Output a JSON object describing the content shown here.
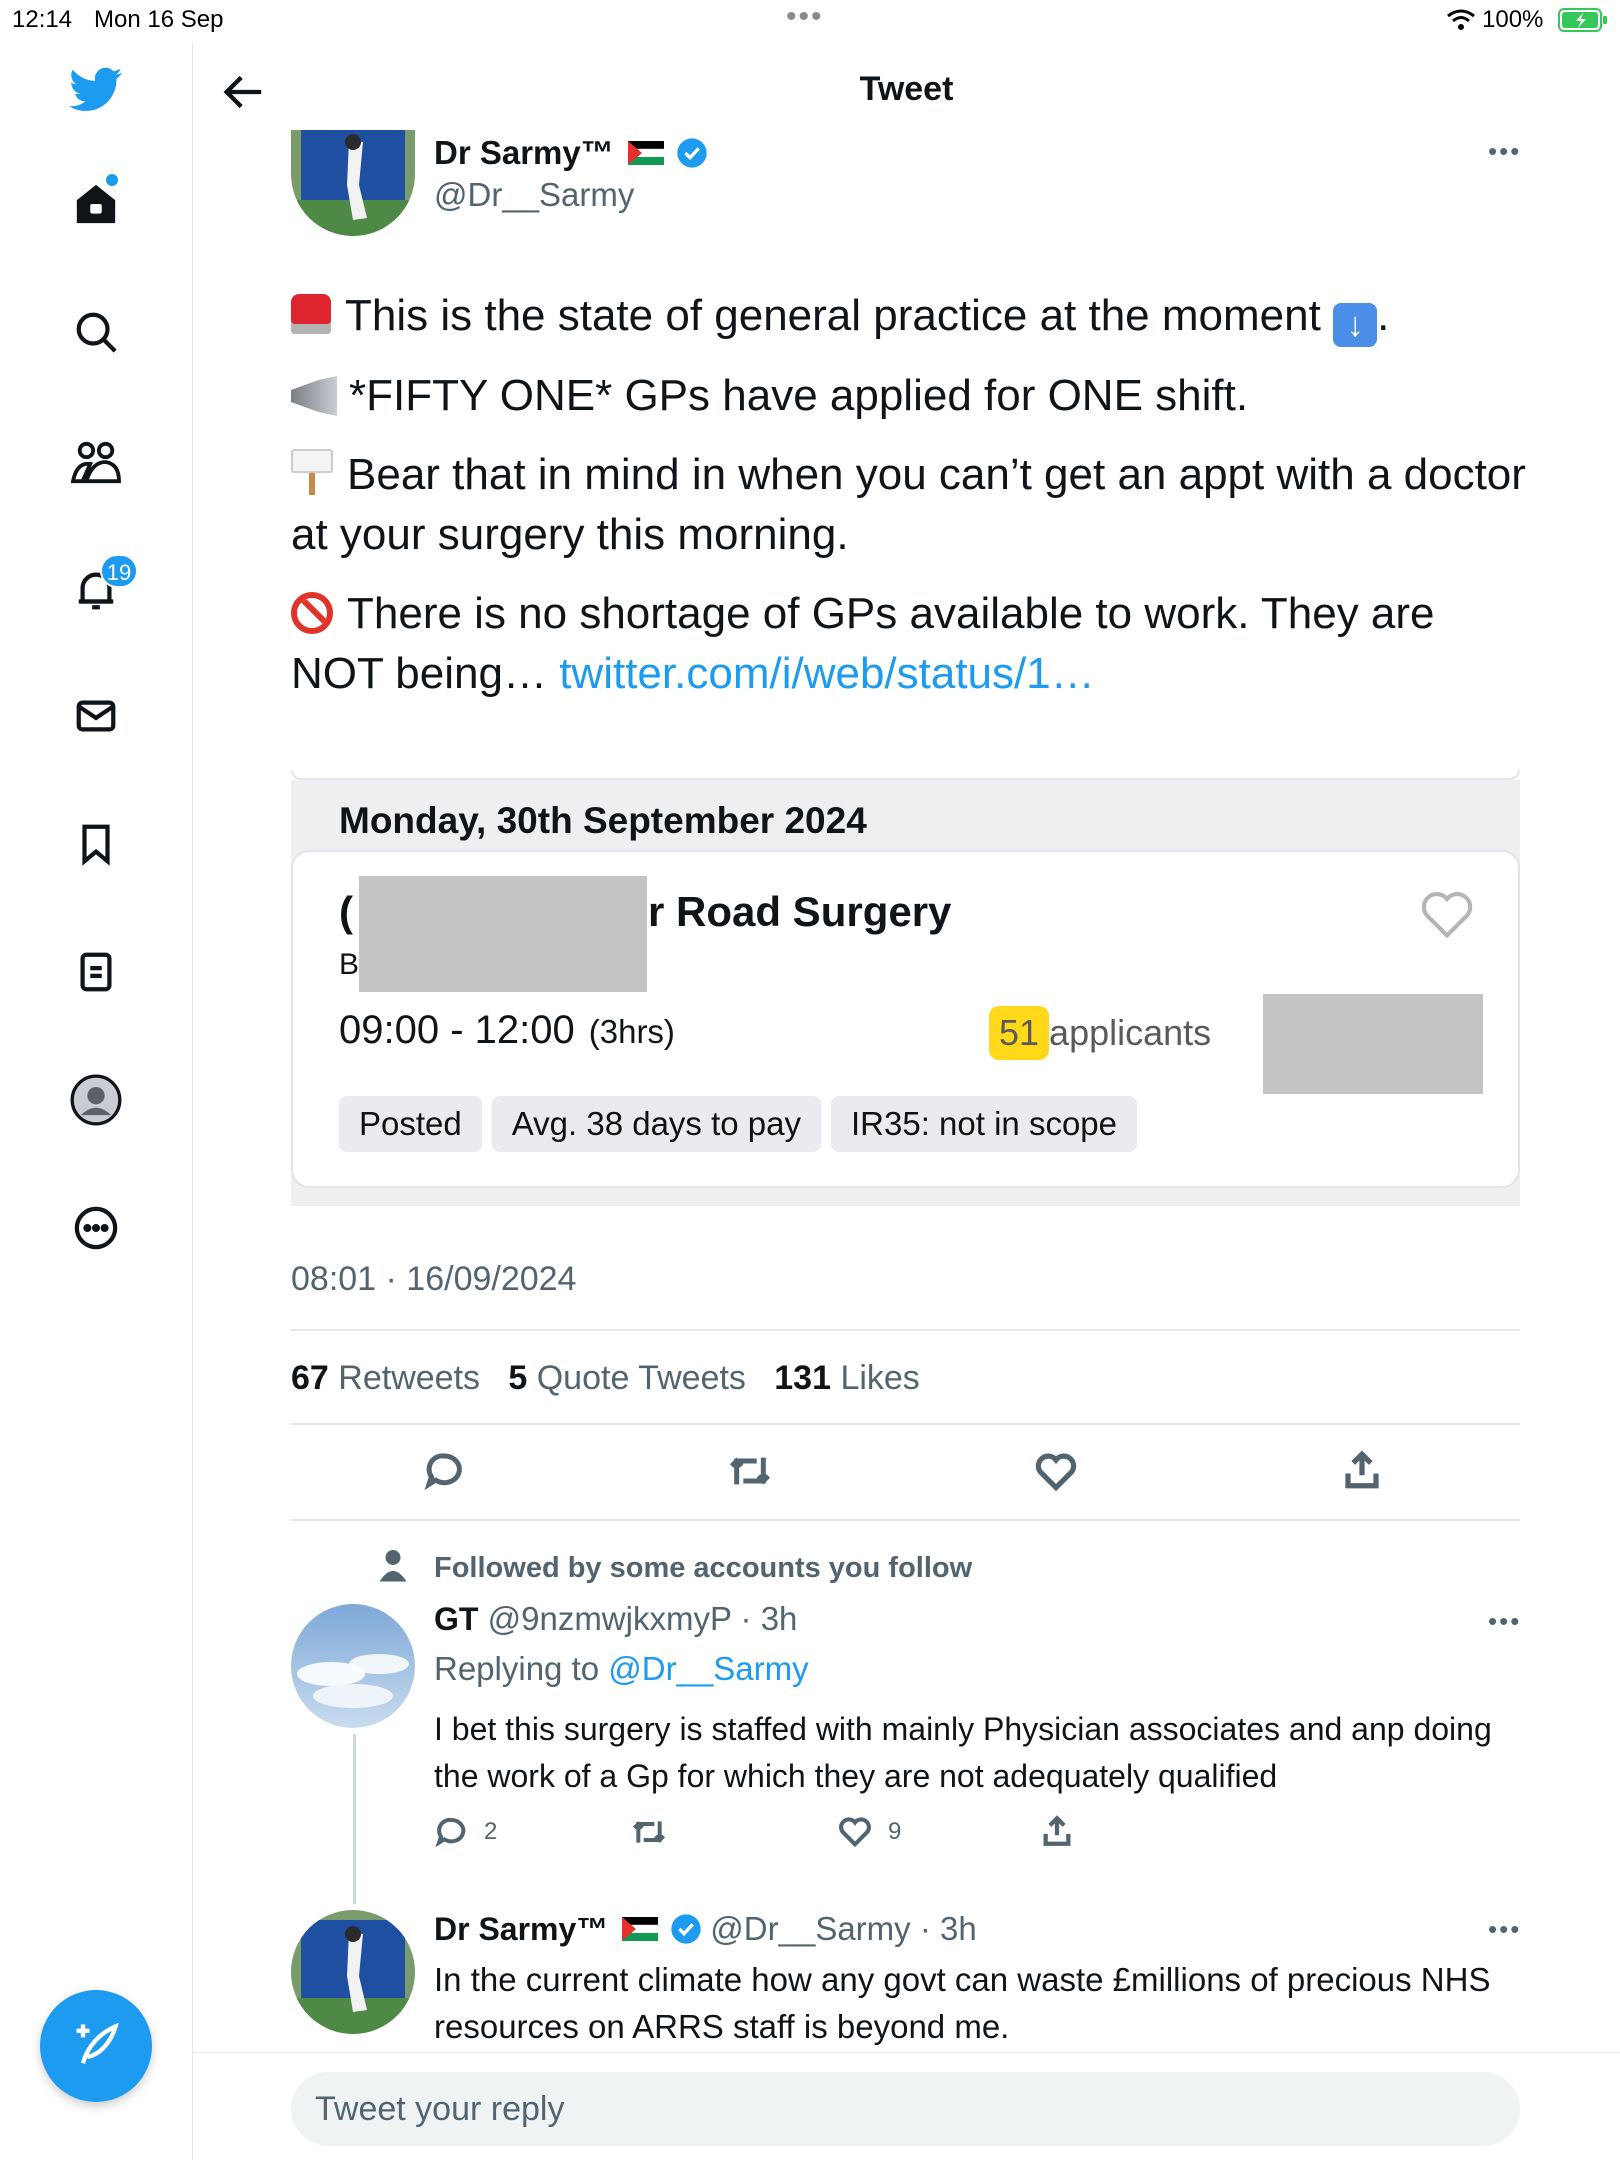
{
  "status": {
    "time": "12:14",
    "date": "Mon 16 Sep",
    "battery": "100%"
  },
  "header": {
    "title": "Tweet"
  },
  "notifications_badge": "19",
  "author": {
    "name": "Dr Sarmy™",
    "handle": "@Dr__Sarmy"
  },
  "tweet": {
    "para1": "This is the state of general practice at the moment",
    "para1_end": ".",
    "para2": "*FIFTY ONE* GPs have applied for ONE shift.",
    "para3": "Bear that in mind in when you can’t get an appt with a doctor at your surgery this morning.",
    "para4": "There is no shortage of GPs available to work. They are NOT being…",
    "link": "twitter.com/i/web/status/1…",
    "timestamp": "08:01 · 16/09/2024"
  },
  "card": {
    "date": "Monday, 30th September 2024",
    "title_prefix": "(",
    "title_suffix": "r Road Surgery",
    "sub": "B",
    "time": "09:00 - 12:00",
    "duration": "(3hrs)",
    "applicants_num": "51",
    "applicants_label": " applicants",
    "pills": [
      "Posted",
      "Avg. 38 days to pay",
      "IR35: not in scope"
    ]
  },
  "stats": {
    "retweets": "67",
    "retweets_label": "Retweets",
    "quotes": "5",
    "quotes_label": "Quote Tweets",
    "likes": "131",
    "likes_label": "Likes"
  },
  "reply1": {
    "social": "Followed by some accounts you follow",
    "name": "GT",
    "handle_time": "@9nzmwjkxmyP · 3h",
    "replying_prefix": "Replying to ",
    "replying_to": "@Dr__Sarmy",
    "text": "I bet this surgery is staffed with mainly Physician associates and anp doing the work of a Gp for which they are not adequately qualified",
    "replies": "2",
    "likes": "9"
  },
  "reply2": {
    "name": "Dr Sarmy™",
    "handle_time": "@Dr__Sarmy · 3h",
    "text": "In the current climate how any govt can waste £millions of precious NHS resources on ARRS staff is beyond me."
  },
  "reply_box": {
    "placeholder": "Tweet your reply"
  },
  "colors": {
    "accent": "#1d9bf0",
    "text": "#0f1419",
    "muted": "#536471",
    "highlight": "#ffd81a",
    "redaction": "#c4c4c4"
  }
}
